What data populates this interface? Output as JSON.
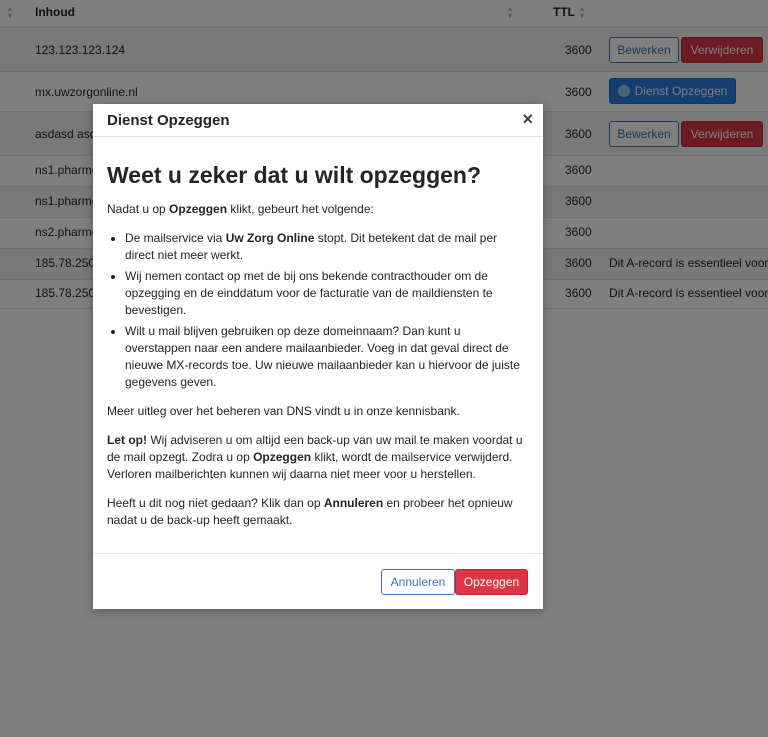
{
  "table": {
    "headers": {
      "content": "Inhoud",
      "ttl": "TTL"
    },
    "rows": [
      {
        "content": "123.123.123.124",
        "ttl": "3600",
        "edit": "Bewerken",
        "delete": "Verwijderen"
      },
      {
        "content": "mx.uwzorgonline.nl",
        "ttl": "3600",
        "cancel_service": "Dienst Opzeggen"
      },
      {
        "content": "asdasd asdasd",
        "ttl": "3600",
        "edit": "Bewerken",
        "delete": "Verwijderen"
      },
      {
        "content": "ns1.pharmeo.nl",
        "ttl": "3600"
      },
      {
        "content": "ns1.pharmeo.nl",
        "ttl": "3600"
      },
      {
        "content": "ns2.pharmeo.nl",
        "ttl": "3600"
      },
      {
        "content": "185.78.250.1",
        "ttl": "3600",
        "note": "Dit A-record is essentieel voor"
      },
      {
        "content": "185.78.250.1",
        "ttl": "3600",
        "note": "Dit A-record is essentieel voor"
      }
    ]
  },
  "modal": {
    "title": "Dienst Opzeggen",
    "close": "×",
    "heading": "Weet u zeker dat u wilt opzeggen?",
    "intro_prefix": "Nadat u op ",
    "intro_bold": "Opzeggen",
    "intro_suffix": " klikt, gebeurt het volgende:",
    "bullet1_prefix": "De mailservice via ",
    "bullet1_bold": "Uw Zorg Online",
    "bullet1_suffix": " stopt. Dit betekent dat de mail per direct niet meer werkt.",
    "bullet2": "Wij nemen contact op met de bij ons bekende contracthouder om de opzegging en de einddatum voor de facturatie van de maildiensten te bevestigen.",
    "bullet3": "Wilt u mail blijven gebruiken op deze domeinnaam? Dan kunt u overstappen naar een andere mailaanbieder. Voeg in dat geval direct de nieuwe MX-records toe. Uw nieuwe mailaanbieder kan u hiervoor de juiste gegevens geven.",
    "kb_text": "Meer uitleg over het beheren van DNS vindt u in onze kennisbank.",
    "warning_bold": "Let op!",
    "warning_part1": " Wij adviseren u om altijd een back-up van uw mail te maken voordat u de mail opzegt. Zodra u op ",
    "warning_bold2": "Opzeggen",
    "warning_part2": " klikt, wordt de mailservice verwijderd. Verloren mailberichten kunnen wij daarna niet meer voor u herstellen.",
    "final_prefix": "Heeft u dit nog niet gedaan? Klik dan op ",
    "final_bold": "Annuleren",
    "final_suffix": " en probeer het opnieuw nadat u de back-up heeft gemaakt.",
    "cancel_button": "Annuleren",
    "confirm_button": "Opzeggen"
  },
  "colors": {
    "danger": "#dc3545",
    "primary": "#2a7ce0",
    "outline": "#3b75b5",
    "overlay": "rgba(0,0,0,0.5)"
  }
}
